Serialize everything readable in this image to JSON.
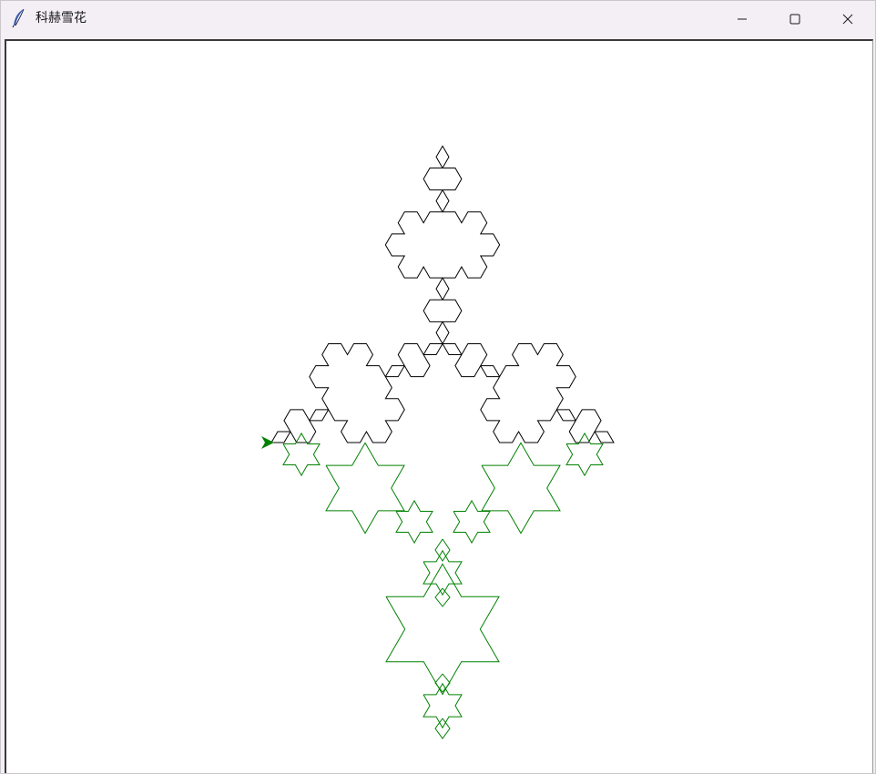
{
  "window": {
    "title": "科赫雪花",
    "minimize_icon": "minimize-icon",
    "maximize_icon": "maximize-icon",
    "close_icon": "close-icon",
    "app_icon": "feather-icon"
  },
  "drawing": {
    "outline_color": "#000000",
    "secondary_color": "#008000",
    "turtle_color": "#008000",
    "turtle_icon": "turtle-arrow-icon"
  }
}
